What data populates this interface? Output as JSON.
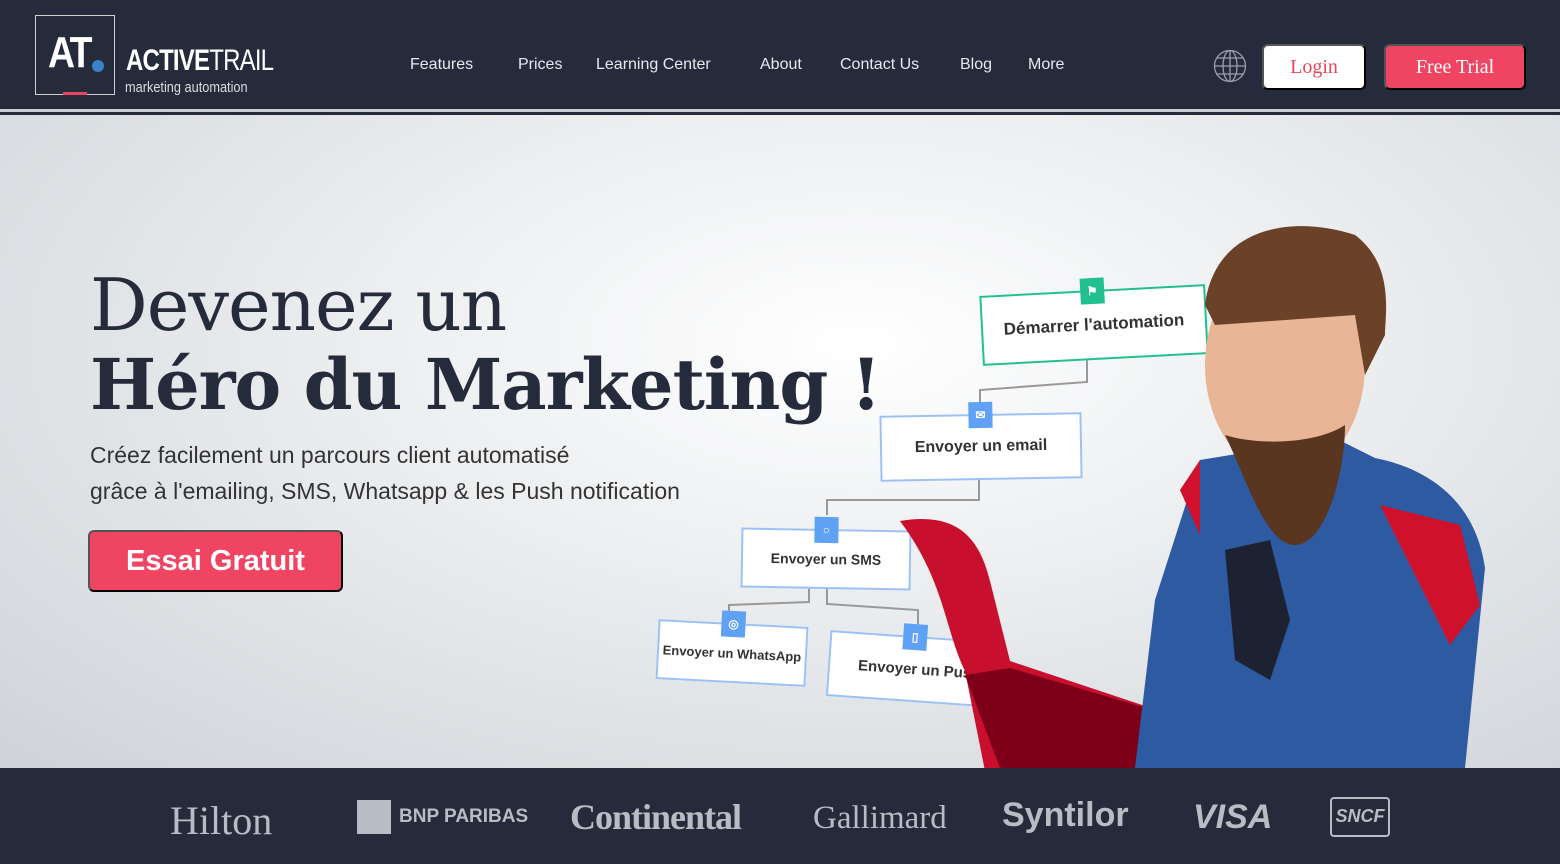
{
  "nav": {
    "logo_letters": "AT",
    "brand_bold": "ACTIVE",
    "brand_light": "TRAIL",
    "tagline": "marketing automation",
    "items": [
      "Features",
      "Prices",
      "Learning Center",
      "About",
      "Contact Us",
      "Blog",
      "More"
    ],
    "language_icon": "globe-icon",
    "login": "Login",
    "free_trial": "Free Trial"
  },
  "hero": {
    "title_line1": "Devenez un",
    "title_line2": "Héro du Marketing !",
    "subtitle_line1": "Créez facilement un parcours client automatisé",
    "subtitle_line2": "grâce à l'emailing, SMS, Whatsapp & les Push notification",
    "cta": "Essai Gratuit",
    "flow": [
      "Démarrer l'automation",
      "Envoyer un email",
      "Envoyer un SMS",
      "Envoyer un WhatsApp",
      "Envoyer un Push"
    ],
    "colors": {
      "accent": "#ef4563",
      "start": "#22c08f",
      "node": "#5ea1f5"
    }
  },
  "clients": [
    "Hilton",
    "BNP PARIBAS",
    "Continental",
    "Gallimard",
    "Syntilor",
    "VISA",
    "SNCF"
  ]
}
